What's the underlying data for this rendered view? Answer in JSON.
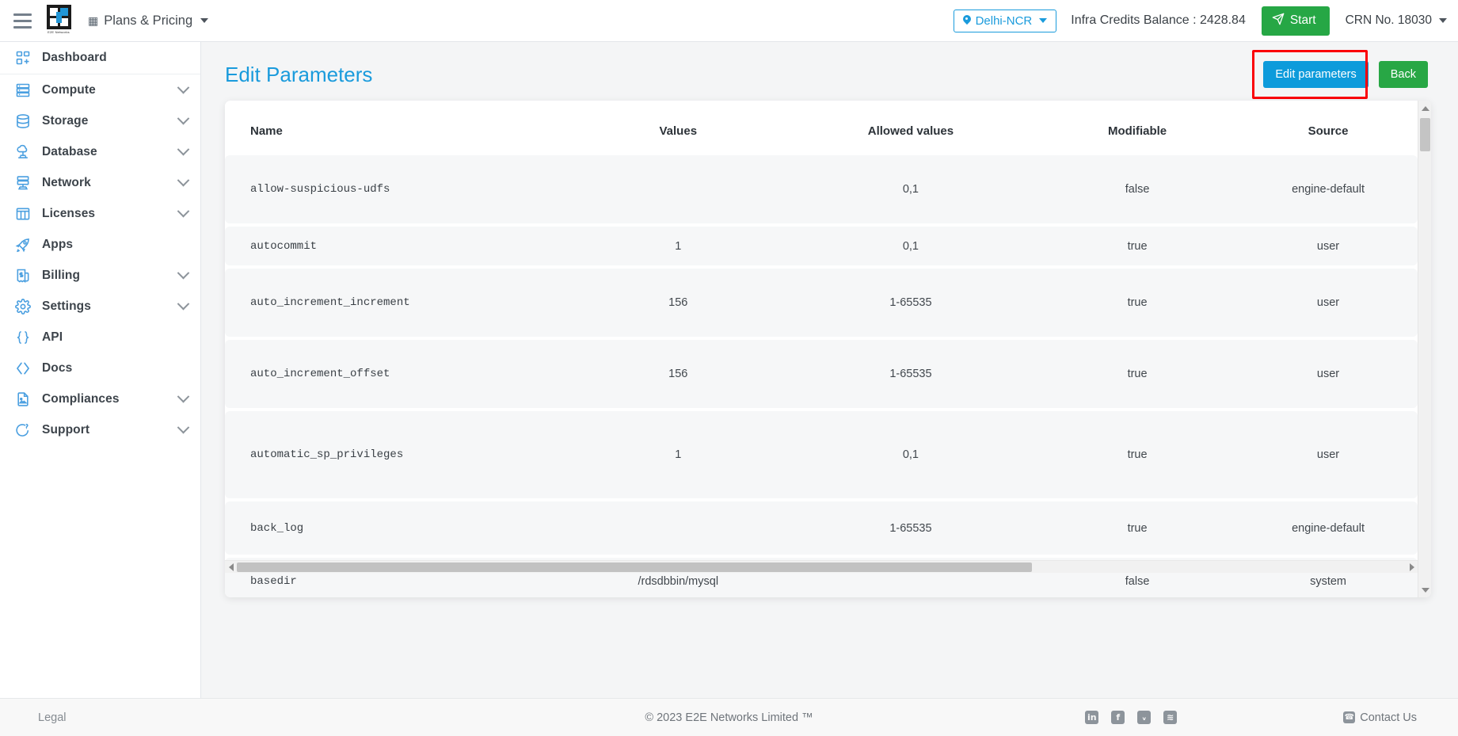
{
  "topbar": {
    "menu_icon": "hamburger-icon",
    "brand": "E2E Networks",
    "plans_label": "Plans & Pricing",
    "plans_icon": "list-icon",
    "region": "Delhi-NCR",
    "region_icon": "location-pin-icon",
    "credits": "Infra Credits Balance : 2428.84",
    "start_label": "Start",
    "start_icon": "paper-plane-icon",
    "crn": "CRN No. 18030"
  },
  "sidebar": {
    "items": [
      {
        "label": "Dashboard",
        "icon": "dashboard-icon",
        "expandable": false
      },
      {
        "label": "Compute",
        "icon": "server-icon",
        "expandable": true
      },
      {
        "label": "Storage",
        "icon": "database-disk-icon",
        "expandable": true
      },
      {
        "label": "Database",
        "icon": "cloud-database-icon",
        "expandable": true
      },
      {
        "label": "Network",
        "icon": "network-icon",
        "expandable": true
      },
      {
        "label": "Licenses",
        "icon": "grid-license-icon",
        "expandable": true
      },
      {
        "label": "Apps",
        "icon": "rocket-icon",
        "expandable": false
      },
      {
        "label": "Billing",
        "icon": "invoice-icon",
        "expandable": true
      },
      {
        "label": "Settings",
        "icon": "gear-icon",
        "expandable": true
      },
      {
        "label": "API",
        "icon": "braces-icon",
        "expandable": false
      },
      {
        "label": "Docs",
        "icon": "code-icon",
        "expandable": false
      },
      {
        "label": "Compliances",
        "icon": "document-icon",
        "expandable": true
      },
      {
        "label": "Support",
        "icon": "lifebuoy-icon",
        "expandable": true
      }
    ]
  },
  "page": {
    "title": "Edit Parameters",
    "edit_button": "Edit parameters",
    "back_button": "Back",
    "highlight_color": "#fb0007",
    "accent_color": "#0d9bdb",
    "success_color": "#28a745"
  },
  "table": {
    "columns": [
      "Name",
      "Values",
      "Allowed values",
      "Modifiable",
      "Source"
    ],
    "rows": [
      {
        "name": "allow-suspicious-udfs",
        "value": "",
        "allowed": "0,1",
        "modifiable": "false",
        "source": "engine-default"
      },
      {
        "name": "autocommit",
        "value": "1",
        "allowed": "0,1",
        "modifiable": "true",
        "source": "user"
      },
      {
        "name": "auto_increment_increment",
        "value": "156",
        "allowed": "1-65535",
        "modifiable": "true",
        "source": "user"
      },
      {
        "name": "auto_increment_offset",
        "value": "156",
        "allowed": "1-65535",
        "modifiable": "true",
        "source": "user"
      },
      {
        "name": "automatic_sp_privileges",
        "value": "1",
        "allowed": "0,1",
        "modifiable": "true",
        "source": "user"
      },
      {
        "name": "back_log",
        "value": "",
        "allowed": "1-65535",
        "modifiable": "true",
        "source": "engine-default"
      },
      {
        "name": "basedir",
        "value": "/rdsdbbin/mysql",
        "allowed": "",
        "modifiable": "false",
        "source": "system"
      }
    ]
  },
  "scroll": {
    "vertical_thumb_position": "top",
    "horizontal_thumb_fraction": "68%"
  },
  "footer": {
    "legal": "Legal",
    "copyright": "© 2023 E2E Networks Limited ™",
    "socials": [
      {
        "name": "linkedin-icon",
        "glyph": "in"
      },
      {
        "name": "facebook-icon",
        "glyph": "f"
      },
      {
        "name": "twitter-icon",
        "glyph": "ᵥ"
      },
      {
        "name": "rss-icon",
        "glyph": "≋"
      }
    ],
    "contact": "Contact Us",
    "contact_icon": "phone-icon"
  }
}
